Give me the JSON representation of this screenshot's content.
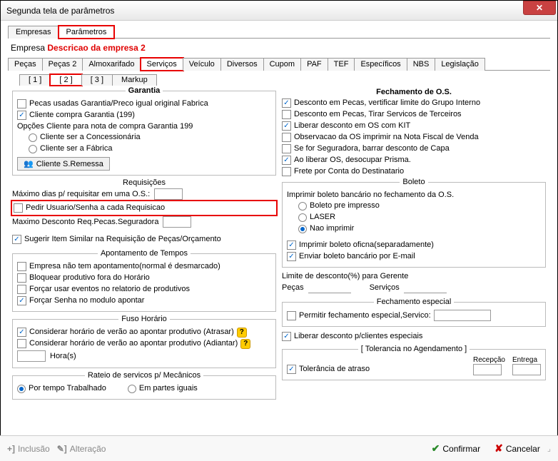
{
  "window": {
    "title": "Segunda tela de parâmetros"
  },
  "topTabs": {
    "empresas": "Empresas",
    "parametros": "Parâmetros"
  },
  "empresa": {
    "label": "Empresa",
    "desc": "Descricao da empresa 2"
  },
  "moduleTabs": {
    "pecas": "Peças",
    "pecas2": "Peças 2",
    "almox": "Almoxarifado",
    "servicos": "Serviços",
    "veiculo": "Veículo",
    "diversos": "Diversos",
    "cupom": "Cupom",
    "paf": "PAF",
    "tef": "TEF",
    "espec": "Específicos",
    "nbs": "NBS",
    "legis": "Legislação"
  },
  "numTabs": {
    "t1": "[ 1 ]",
    "t2": "[ 2 ]",
    "t3": "[ 3 ]",
    "markup": "Markup"
  },
  "garantia": {
    "title": "Garantia",
    "pecasUsadas": "Pecas usadas Garantia/Preco igual original Fabrica",
    "clienteCompra": "Cliente compra Garantia (199)",
    "opcoesCliente": "Opções Cliente para nota de compra Garantia 199",
    "concess": "Cliente ser a Concessionária",
    "fabrica": "Cliente ser a Fábrica",
    "btnRemessa": "Cliente S.Remessa"
  },
  "requisicoes": {
    "title": "Requisições",
    "maxDias": "Máximo dias p/ requisitar em uma O.S.:",
    "pedirUsuario": "Pedir Usuario/Senha a cada Requisicao",
    "maxDesc": "Maximo Desconto Req.Pecas.Seguradora",
    "sugerir": "Sugerir Item Similar na Requisição de Peças/Orçamento"
  },
  "apontamento": {
    "title": "Apontamento de Tempos",
    "naoTem": "Empresa não tem apontamento(normal é desmarcado)",
    "bloquear": "Bloquear produtivo fora do Horário",
    "forcarEv": "Forçar usar eventos no relatorio de produtivos",
    "forcarSenha": "Forçar Senha no modulo apontar"
  },
  "fuso": {
    "title": "Fuso Horário",
    "atrasar": "Considerar horário de verão ao apontar produtivo (Atrasar)",
    "adiantar": "Considerar horário de verão ao apontar produtivo (Adiantar)",
    "horas": "Hora(s)"
  },
  "rateio": {
    "title": "Rateio de servicos p/ Mecânicos",
    "tempo": "Por tempo Trabalhado",
    "partes": "Em partes iguais"
  },
  "fechamento": {
    "title": "Fechamento de O.S.",
    "descPecas": "Desconto em Pecas, vertificar limite do Grupo Interno",
    "descTerc": "Desconto em Pecas, Tirar Servicos de Terceiros",
    "liberarKit": "Liberar desconto em OS com KIT",
    "obs": "Observacao da OS imprimir na Nota Fiscal de Venda",
    "seguradora": "Se for Seguradora, barrar desconto de Capa",
    "desocupar": "Ao liberar OS, desocupar Prisma.",
    "frete": "Frete por Conta do Destinatario"
  },
  "boleto": {
    "title": "Boleto",
    "imprimirLabel": "Imprimir boleto bancário no fechamento da O.S.",
    "pre": "Boleto pre impresso",
    "laser": "LASER",
    "nao": "Nao imprimir",
    "oficina": "Imprimir boleto oficna(separadamente)",
    "email": "Enviar boleto bancário por E-mail"
  },
  "limite": {
    "label": "Limite de desconto(%) para Gerente",
    "pecas": "Peças",
    "servicos": "Serviços"
  },
  "fechEsp": {
    "title": "Fechamento especial",
    "permitir": "Permitir fechamento especial,Servico:"
  },
  "liberarEsp": "Liberar desconto p/clientes especiais",
  "tolerancia": {
    "title": "[ Tolerancia no Agendamento ]",
    "atraso": "Tolerância de atraso",
    "recepcao": "Recepção",
    "entrega": "Entrega"
  },
  "footer": {
    "inclusao": "Inclusão",
    "alteracao": "Alteração",
    "confirmar": "Confirmar",
    "cancelar": "Cancelar"
  }
}
